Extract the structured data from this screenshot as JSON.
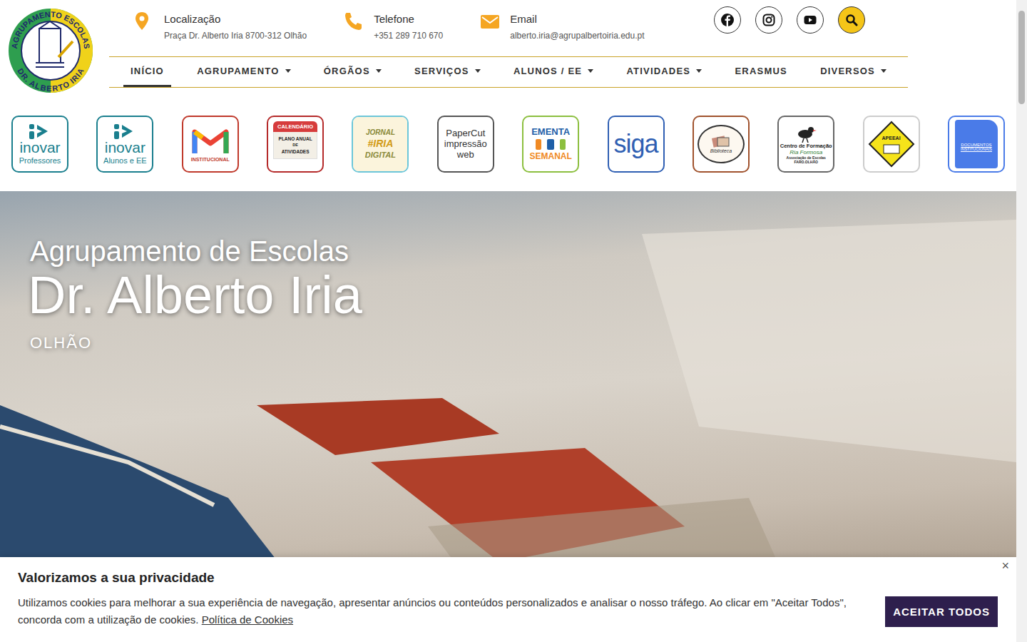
{
  "logo": {
    "top": "AGRUPAMENTO ESCOLAS",
    "bottom": "DR. ALBERTO IRIA"
  },
  "contacts": [
    {
      "kind": "location",
      "label": "Localização",
      "value": "Praça Dr. Alberto Iria 8700-312 Olhão"
    },
    {
      "kind": "phone",
      "label": "Telefone",
      "value": "+351 289 710 670"
    },
    {
      "kind": "email",
      "label": "Email",
      "value": "alberto.iria@agrupalbertoiria.edu.pt"
    }
  ],
  "social": [
    {
      "kind": "facebook"
    },
    {
      "kind": "instagram"
    },
    {
      "kind": "youtube"
    },
    {
      "kind": "search"
    }
  ],
  "nav": [
    {
      "label": "INÍCIO",
      "selected": true,
      "dropdown": false
    },
    {
      "label": "AGRUPAMENTO",
      "selected": false,
      "dropdown": true
    },
    {
      "label": "ÓRGÃOS",
      "selected": false,
      "dropdown": true
    },
    {
      "label": "SERVIÇOS",
      "selected": false,
      "dropdown": true
    },
    {
      "label": "ALUNOS / EE",
      "selected": false,
      "dropdown": true
    },
    {
      "label": "ATIVIDADES",
      "selected": false,
      "dropdown": true
    },
    {
      "label": "ERASMUS",
      "selected": false,
      "dropdown": false
    },
    {
      "label": "DIVERSOS",
      "selected": false,
      "dropdown": true
    }
  ],
  "quick_links": [
    {
      "kind": "inovar",
      "lines": [
        "inovar",
        "Professores"
      ],
      "color": "#1a7f8e"
    },
    {
      "kind": "inovar",
      "lines": [
        "inovar",
        "Alunos e EE"
      ],
      "color": "#1a7f8e"
    },
    {
      "kind": "gmail",
      "lines": [
        "INSTITUCIONAL"
      ],
      "color": "#c0392b"
    },
    {
      "kind": "calendar",
      "lines": [
        "CALENDÁRIO",
        "PLANO ANUAL",
        "DE",
        "ATIVIDADES"
      ],
      "color": "#b52a2a"
    },
    {
      "kind": "journal",
      "lines": [
        "JORNAL",
        "#IRIA",
        "DIGITAL"
      ],
      "color": "#6cc6d9"
    },
    {
      "kind": "papercut",
      "lines": [
        "PaperCut",
        "impressão",
        "web"
      ],
      "color": "#555555"
    },
    {
      "kind": "ementa",
      "lines": [
        "EMENTA",
        "SEMANAL"
      ],
      "color": "#8cbf3f"
    },
    {
      "kind": "siga",
      "lines": [
        "siga"
      ],
      "color": "#2f5fb3"
    },
    {
      "kind": "biblioteca",
      "lines": [
        "Biblioteca"
      ],
      "color": "#a0522d"
    },
    {
      "kind": "centro",
      "lines": [
        "Centro de Formação",
        "Ria Formosa",
        "Associação de Escolas FARO.OLHÃO"
      ],
      "color": "#666666"
    },
    {
      "kind": "apeeai",
      "lines": [
        "APEEAI"
      ],
      "color": "#cccccc"
    },
    {
      "kind": "docs",
      "lines": [
        "DOCUMENTOS",
        "INSTITUCIONAIS"
      ],
      "color": "#4a7be8"
    }
  ],
  "hero": {
    "kicker": "Agrupamento de Escolas",
    "title": "Dr. Alberto Iria",
    "subtitle": "OLHÃO"
  },
  "cookie_banner": {
    "title": "Valorizamos a sua privacidade",
    "text": "Utilizamos cookies para melhorar a sua experiência de navegação, apresentar anúncios ou conteúdos personalizados e analisar o nosso tráfego. Ao clicar em \"Aceitar Todos\", concorda com a utilização de cookies.",
    "link": "Política de Cookies",
    "button": "ACEITAR TODOS",
    "close": "×"
  },
  "scrollbar": {
    "level": 0.15
  }
}
